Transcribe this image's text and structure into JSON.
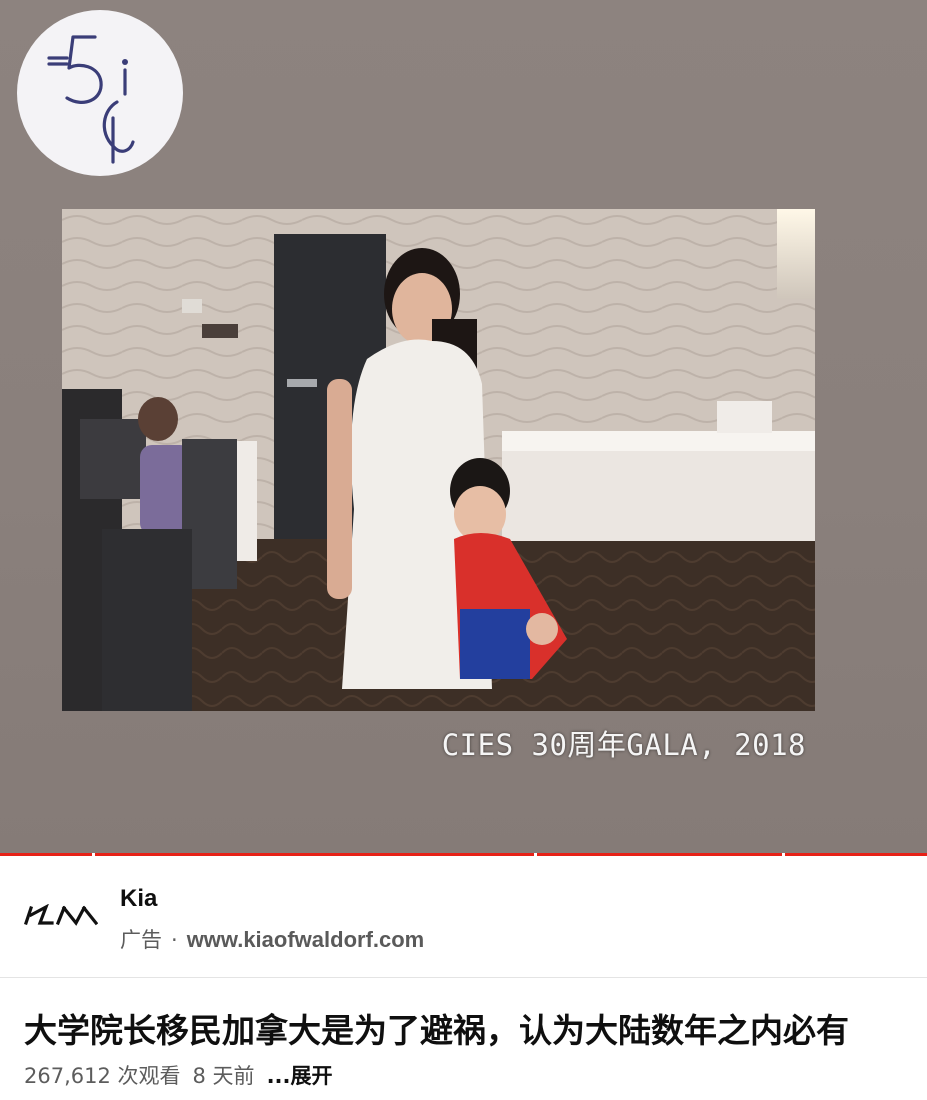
{
  "video": {
    "channel_logo_icon": "5c-monogram-logo",
    "photo_caption": "CIES 30周年GALA, 2018",
    "progress_color": "#e62117"
  },
  "ad": {
    "brand_logo_icon": "kia-logo",
    "advertiser": "Kia",
    "label": "广告",
    "separator": "·",
    "url": "www.kiaofwaldorf.com"
  },
  "video_info": {
    "title": "大学院长移民加拿大是为了避祸，认为大陆数年之内必有",
    "views": "267,612 次观看",
    "age": "8 天前",
    "expand": "...展开"
  }
}
